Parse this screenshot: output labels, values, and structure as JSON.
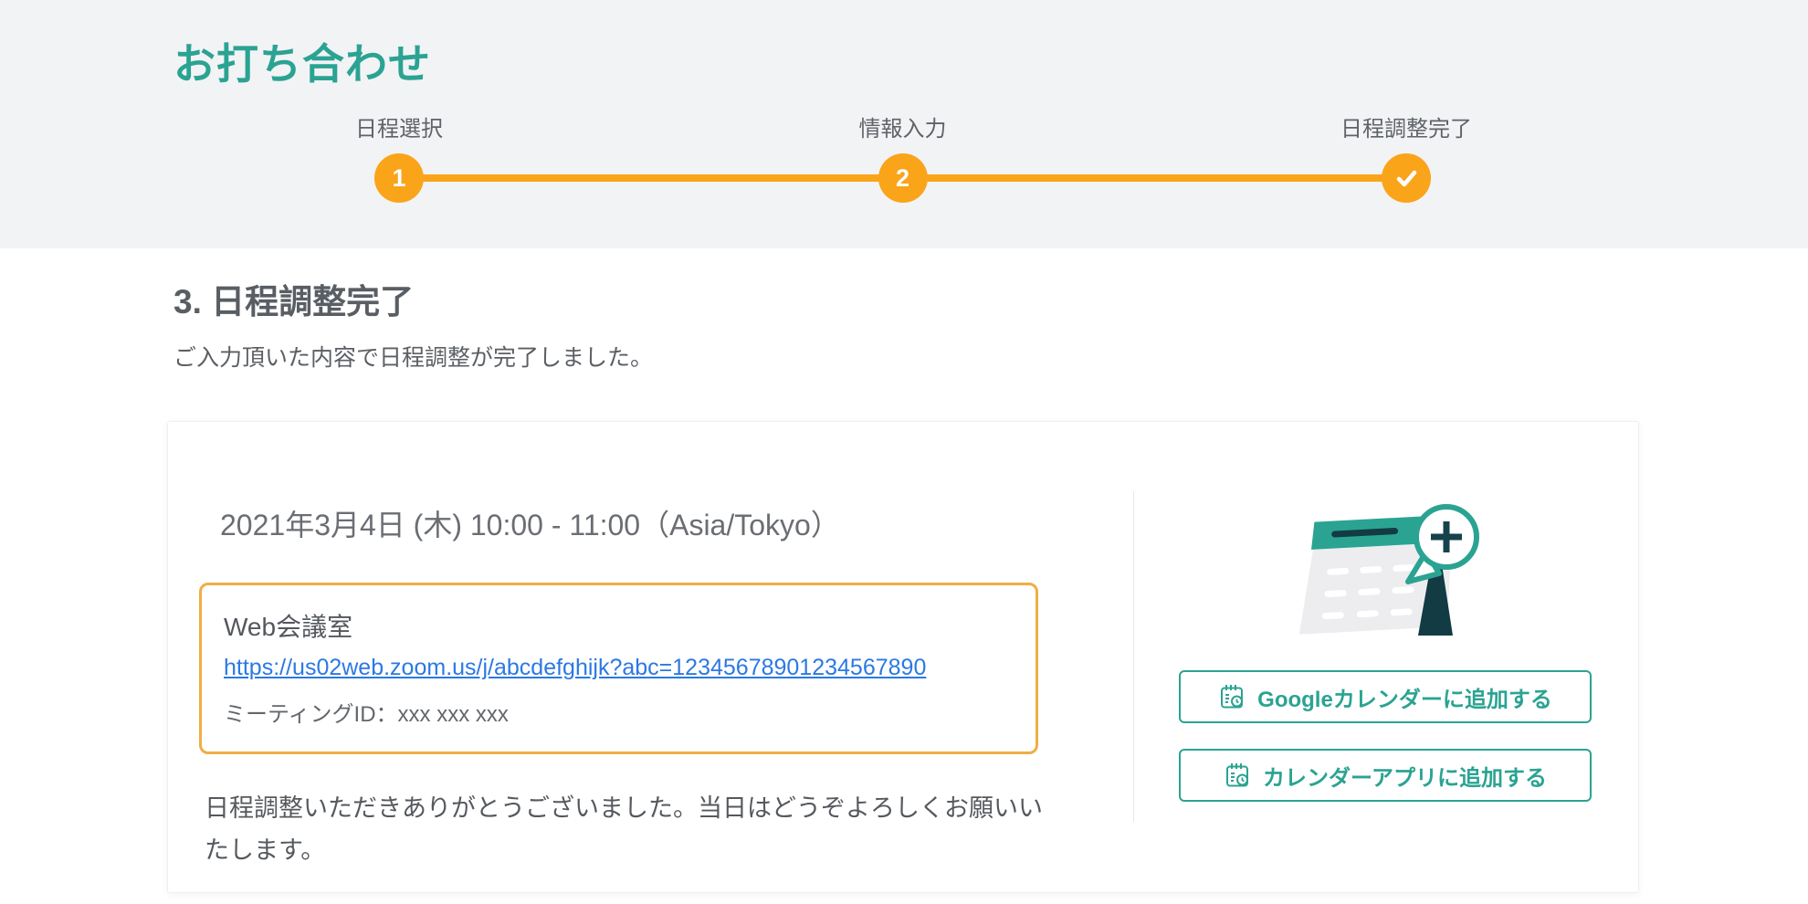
{
  "page": {
    "title": "お打ち合わせ"
  },
  "stepper": {
    "steps": [
      {
        "label": "日程選択",
        "number": "1",
        "icon": null
      },
      {
        "label": "情報入力",
        "number": "2",
        "icon": null
      },
      {
        "label": "日程調整完了",
        "number": null,
        "icon": "check-icon"
      }
    ]
  },
  "section": {
    "heading": "3. 日程調整完了",
    "description": "ご入力頂いた内容で日程調整が完了しました。"
  },
  "card": {
    "datetime": "2021年3月4日 (木) 10:00 - 11:00（Asia/Tokyo）",
    "meeting": {
      "title": "Web会議室",
      "url": "https://us02web.zoom.us/j/abcdefghijk?abc=12345678901234567890",
      "meeting_id": "ミーティングID：xxx xxx xxx"
    },
    "thanks": "日程調整いただきありがとうございました。当日はどうぞよろしくお願いいたします。",
    "buttons": [
      {
        "label": "Googleカレンダーに追加する"
      },
      {
        "label": "カレンダーアプリに追加する"
      }
    ]
  },
  "colors": {
    "accent_teal": "#2BA392",
    "accent_orange": "#FAA41A",
    "box_border_orange": "#EFAE45",
    "link_blue": "#2B79E3",
    "header_background": "#F2F3F5"
  }
}
